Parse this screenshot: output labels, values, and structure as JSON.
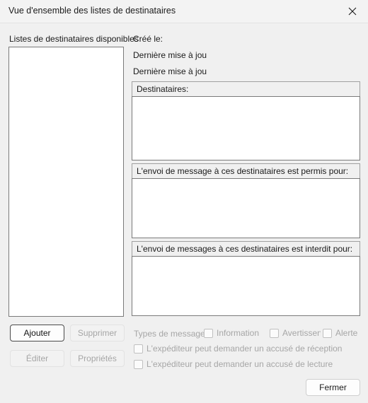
{
  "window": {
    "title": "Vue d'ensemble des listes de destinataires",
    "close_icon": "close-icon"
  },
  "left_panel": {
    "label": "Listes de destinataires disponibles",
    "list_items": []
  },
  "info": {
    "created_label": "Créé le:",
    "last_update_label_1": "Dernière mise à jou",
    "last_update_label_2": "Dernière mise à jou"
  },
  "groups": [
    {
      "header": "Destinataires:",
      "items": []
    },
    {
      "header": "L'envoi de message à ces destinataires est permis pour:",
      "items": []
    },
    {
      "header": "L'envoi de messages à ces destinataires est interdit pour:",
      "items": []
    }
  ],
  "buttons": {
    "add": "Ajouter",
    "delete": "Supprimer",
    "edit": "Éditer",
    "properties": "Propriétés",
    "close": "Fermer"
  },
  "options": {
    "message_types_label": "Types de message",
    "information": "Information",
    "warning": "Avertissen",
    "alert": "Alerte",
    "delivery_receipt": "L'expéditeur peut demander un accusé de réception",
    "read_receipt": "L'expéditeur peut demander un accusé de lecture"
  },
  "colors": {
    "window_background": "#f0f0f0",
    "titlebar_background": "#f3f3f3",
    "field_background": "#ffffff",
    "field_border": "#7a7a7a",
    "disabled_text": "#a6a6a6",
    "text": "#1a1a1a"
  }
}
